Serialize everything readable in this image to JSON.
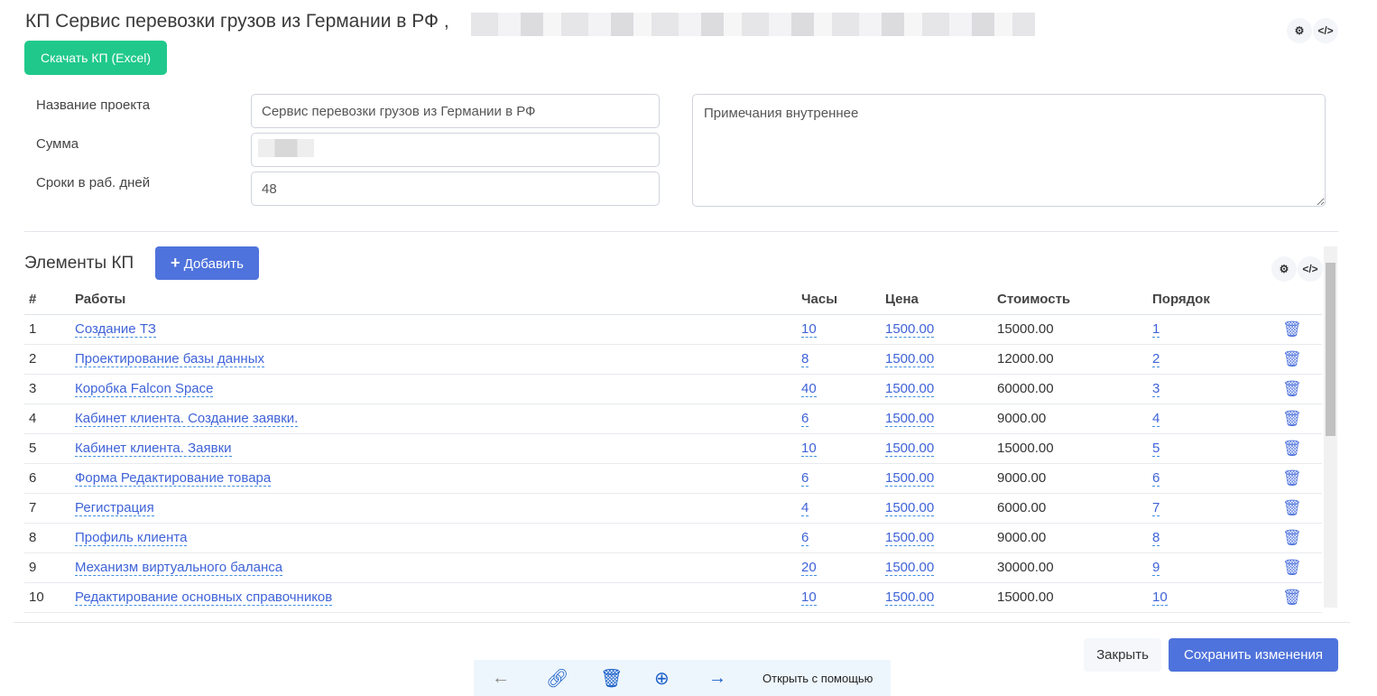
{
  "header": {
    "title": "КП Сервис перевозки грузов из Германии в РФ ,",
    "download_label": "Скачать КП (Excel)",
    "settings_icon": "gears-icon",
    "code_icon": "code-icon"
  },
  "form": {
    "project_label": "Название проекта",
    "project_value": "Сервис перевозки грузов из Германии в РФ",
    "sum_label": "Сумма",
    "days_label": "Сроки в раб. дней",
    "days_value": "48",
    "notes_placeholder": "Примечания внутреннее"
  },
  "items": {
    "title": "Элементы КП",
    "add_label": "Добавить",
    "columns": [
      "#",
      "Работы",
      "Часы",
      "Цена",
      "Стоимость",
      "Порядок"
    ],
    "rows": [
      [
        "1",
        "Создание ТЗ",
        "10",
        "1500.00",
        "15000.00",
        "1"
      ],
      [
        "2",
        "Проектирование базы данных",
        "8",
        "1500.00",
        "12000.00",
        "2"
      ],
      [
        "3",
        "Коробка Falcon Space",
        "40",
        "1500.00",
        "60000.00",
        "3"
      ],
      [
        "4",
        "Кабинет клиента. Создание заявки.",
        "6",
        "1500.00",
        "9000.00",
        "4"
      ],
      [
        "5",
        "Кабинет клиента. Заявки",
        "10",
        "1500.00",
        "15000.00",
        "5"
      ],
      [
        "6",
        "Форма Редактирование товара",
        "6",
        "1500.00",
        "9000.00",
        "6"
      ],
      [
        "7",
        "Регистрация",
        "4",
        "1500.00",
        "6000.00",
        "7"
      ],
      [
        "8",
        "Профиль клиента",
        "6",
        "1500.00",
        "9000.00",
        "8"
      ],
      [
        "9",
        "Механизм виртуального баланса",
        "20",
        "1500.00",
        "30000.00",
        "9"
      ],
      [
        "10",
        "Редактирование основных справочников",
        "10",
        "1500.00",
        "15000.00",
        "10"
      ]
    ]
  },
  "footer": {
    "close_label": "Закрыть",
    "save_label": "Сохранить изменения"
  },
  "viewer_bar": {
    "open_with": "Открыть с помощью"
  },
  "colors": {
    "green": "#20c98b",
    "blue": "#4f73dc"
  }
}
